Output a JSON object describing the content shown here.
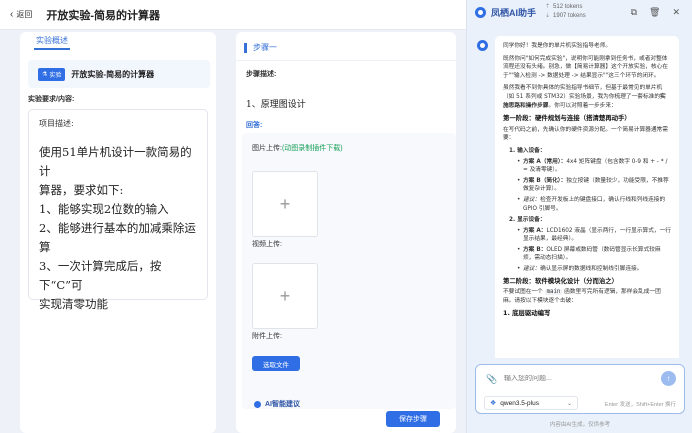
{
  "header": {
    "back_label": "返回",
    "title": "开放实验-简易的计算器"
  },
  "left": {
    "tab_label": "实验概述",
    "badge_label": "实验",
    "experiment_name": "开放实验-简易的计算器",
    "req_label": "实验要求/内容:",
    "req_desc": "项目描述:",
    "req_lines": [
      "使用51单片机设计一款简易的计",
      "算器，要求如下:",
      "1、能够实现2位数的输入",
      "2、能够进行基本的加减乘除运算",
      "3、一次计算完成后，按下“C”可",
      "实现清零功能"
    ]
  },
  "middle": {
    "step_label": "步骤一",
    "step_desc_label": "步骤描述:",
    "step_content": "1、原理图设计",
    "answer_label": "回答:",
    "image_upload_label": "图片上传:",
    "image_upload_hint": "(动图录制插件下载)",
    "video_upload_label": "视频上传:",
    "attach_upload_label": "附件上传:",
    "choose_file_label": "选取文件",
    "ai_suggest_label": "AI智能建议",
    "save_step_label": "保存步骤"
  },
  "ai": {
    "title": "凤栖AI助手",
    "tokens_in": "512 tokens",
    "tokens_out": "1907 tokens",
    "message": {
      "p1": "同学你好！我是你的单片机实验指导老师。",
      "p2": "既然你问\"如何完成实验\"，说明你可能刚拿到任务书，或者对整体流程还没有头绪。别急，做【简易计算器】这个开放实验，核心在于\"\"输入检测 -> 数据处理 -> 结果显示\"\"这三个环节的闭环。",
      "p3_pre": "虽然我看不到你具体的实验指导书细节，但基于最常见的单片机（如 51 系列或 STM32）实验场景，我为你梳理了一套标准的",
      "p3_bold": "实施思路和操作步骤",
      "p3_post": "。你可以对照着一步步来：",
      "phase1": "第一阶段：硬件规划与连接（搭清楚再动手）",
      "phase1_intro": "在写代码之前，先确认你的硬件资源分配。一个简易计算器通常需要：",
      "s1_title": "1. 输入设备：",
      "s1_a_label": "方案 A（常用）：",
      "s1_a": "4x4 矩阵键盘（包含数字 0-9 和 + - * / = 及清零键）。",
      "s1_b_label": "方案 B（简化）：",
      "s1_b": "独立按键（数量较少，功能受限，不推荐做复杂计算）。",
      "s1_tip_label": "建议：",
      "s1_tip": "检查开发板上的键盘接口，确认行线和列线连接的 GPIO 引脚号。",
      "s2_title": "2. 显示设备：",
      "s2_a_label": "方案 A：",
      "s2_a": "LCD1602 液晶（显示两行，一行显示算式，一行显示结果，最经典）。",
      "s2_b_label": "方案 B：",
      "s2_b": "OLED 屏幕或数码管（数码管显示长算式较麻烦，需动态扫描）。",
      "s2_tip_label": "建议：",
      "s2_tip": "确认显示屏的数据线和控制线引脚连接。",
      "phase2": "第二阶段：软件模块化设计（分而治之）",
      "phase2_pre": "不要试图在一个",
      "phase2_code": "main",
      "phase2_post": "函数里写完所有逻辑，那样会乱成一团麻。请按以下模块逐个击破：",
      "s3_title": "1. 底层驱动编写"
    },
    "input_placeholder": "输入您的问题...",
    "model": "qwen3.5-plus",
    "hint": "Enter 发送，Shift+Enter 换行",
    "footer": "内容由AI生成，仅供参考"
  }
}
